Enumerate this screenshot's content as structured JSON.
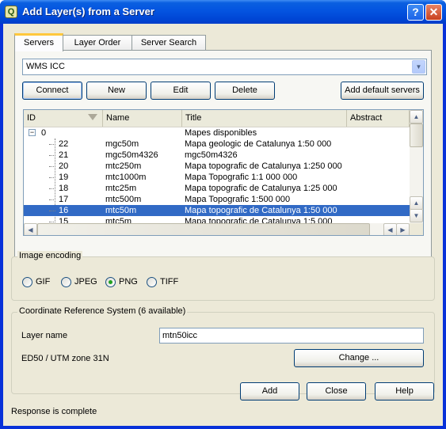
{
  "window": {
    "title": "Add Layer(s) from a Server",
    "help_glyph": "?",
    "close_glyph": "✕",
    "icon_glyph": "Q"
  },
  "tabs": [
    {
      "label": "Servers",
      "active": true
    },
    {
      "label": "Layer Order",
      "active": false
    },
    {
      "label": "Server Search",
      "active": false
    }
  ],
  "server_combo": {
    "value": "WMS ICC"
  },
  "server_buttons": {
    "connect": "Connect",
    "new": "New",
    "edit": "Edit",
    "delete": "Delete",
    "add_default": "Add default servers"
  },
  "layers_table": {
    "columns": [
      "ID",
      "Name",
      "Title",
      "Abstract"
    ],
    "rows": [
      {
        "id": "0",
        "name": "",
        "title": "Mapes disponibles",
        "selected": false,
        "root": true
      },
      {
        "id": "22",
        "name": "mgc50m",
        "title": "Mapa geologic de Catalunya 1:50 000",
        "selected": false
      },
      {
        "id": "21",
        "name": "mgc50m4326",
        "title": "mgc50m4326",
        "selected": false
      },
      {
        "id": "20",
        "name": "mtc250m",
        "title": "Mapa topografic de Catalunya 1:250 000",
        "selected": false
      },
      {
        "id": "19",
        "name": "mtc1000m",
        "title": "Mapa Topografic 1:1 000 000",
        "selected": false
      },
      {
        "id": "18",
        "name": "mtc25m",
        "title": "Mapa topografic de Catalunya 1:25 000",
        "selected": false
      },
      {
        "id": "17",
        "name": "mtc500m",
        "title": "Mapa Topografic 1:500 000",
        "selected": false
      },
      {
        "id": "16",
        "name": "mtc50m",
        "title": "Mapa topografic de Catalunya 1:50 000",
        "selected": true
      },
      {
        "id": "15",
        "name": "mtc5m",
        "title": "Mapa topografic de Catalunya 1:5 000",
        "selected": false
      }
    ],
    "expander_glyph": "−"
  },
  "image_encoding": {
    "label": "Image encoding",
    "options": [
      {
        "label": "GIF",
        "checked": false
      },
      {
        "label": "JPEG",
        "checked": false
      },
      {
        "label": "PNG",
        "checked": true
      },
      {
        "label": "TIFF",
        "checked": false
      }
    ]
  },
  "crs": {
    "label": "Coordinate Reference System (6 available)",
    "layer_name_label": "Layer name",
    "layer_name_value": "mtn50icc",
    "current_crs": "ED50 / UTM zone 31N",
    "change_label": "Change ..."
  },
  "dialog_buttons": {
    "add": "Add",
    "close": "Close",
    "help": "Help"
  },
  "status": "Response is complete",
  "colors": {
    "selection": "#316ac5",
    "titlebar": "#0454e0",
    "dialog_bg": "#ece9d8"
  }
}
